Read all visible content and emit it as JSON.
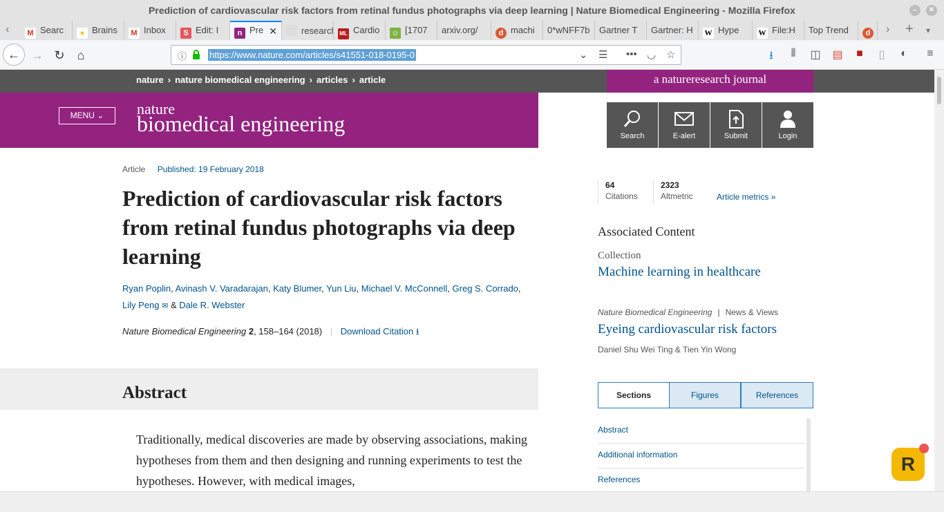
{
  "window": {
    "title": "Prediction of cardiovascular risk factors from retinal fundus photographs via deep learning | Nature Biomedical Engineering - Mozilla Firefox"
  },
  "tabs": [
    {
      "label": "Searc",
      "icon": "gmail-icon",
      "color": "#d93025"
    },
    {
      "label": "Brains",
      "icon": "bulb-icon",
      "color": "#f5c518"
    },
    {
      "label": "Inbox",
      "icon": "gmail-icon",
      "color": "#d93025"
    },
    {
      "label": "Edit: I",
      "icon": "s-icon",
      "color": "#e8555f"
    },
    {
      "label": "Pre",
      "icon": "nature-icon",
      "color": "#93237f"
    },
    {
      "label": "research.c",
      "icon": "blank-icon",
      "color": "#cccccc"
    },
    {
      "label": "Cardio",
      "icon": "ml-icon",
      "color": "#b71c1c"
    },
    {
      "label": "[1707",
      "icon": "smiley-icon",
      "color": "#7cb342"
    },
    {
      "label": "arxiv.org/",
      "icon": "blank-icon",
      "color": "#cccccc"
    },
    {
      "label": "machi",
      "icon": "duckduckgo-icon",
      "color": "#de5833"
    },
    {
      "label": "0*wNFF7b",
      "icon": "blank-icon",
      "color": "#cccccc"
    },
    {
      "label": "Gartner T",
      "icon": "blank-icon",
      "color": "#cccccc"
    },
    {
      "label": "Gartner: H",
      "icon": "blank-icon",
      "color": "#cccccc"
    },
    {
      "label": "Hype",
      "icon": "wikipedia-icon",
      "color": "#ffffff"
    },
    {
      "label": "File:H",
      "icon": "wikipedia-icon",
      "color": "#ffffff"
    },
    {
      "label": "Top Trend",
      "icon": "blank-icon",
      "color": "#cccccc"
    }
  ],
  "urlbar": {
    "url": "https://www.nature.com/articles/s41551-018-0195-0"
  },
  "site": {
    "breadcrumbs": [
      "nature",
      "nature biomedical engineering",
      "articles",
      "article"
    ],
    "nr_label": "a natureresearch journal",
    "menu_label": "MENU",
    "logo_line1": "nature",
    "logo_line2": "biomedical engineering",
    "actions": [
      "Search",
      "E-alert",
      "Submit",
      "Login"
    ]
  },
  "article": {
    "type": "Article",
    "published": "Published: 19 February 2018",
    "title": "Prediction of cardiovascular risk factors from retinal fundus photographs via deep learning",
    "authors": [
      "Ryan Poplin",
      "Avinash V. Varadarajan",
      "Katy Blumer",
      "Yun Liu",
      "Michael V. McConnell",
      "Greg S. Corrado",
      "Lily Peng",
      "Dale R. Webster"
    ],
    "journal": "Nature Biomedical Engineering",
    "volume": "2",
    "pages": ", 158–164 (2018)",
    "download_citation": "Download Citation",
    "abstract_heading": "Abstract",
    "abstract_text": "Traditionally, medical discoveries are made by observing associations, making hypotheses from them and then designing and running experiments to test the hypotheses. However, with medical images,"
  },
  "sidebar": {
    "citations_value": "64",
    "citations_label": "Citations",
    "altmetric_value": "2323",
    "altmetric_label": "Altmetric",
    "metrics_link": "Article metrics",
    "associated_heading": "Associated Content",
    "collection_label": "Collection",
    "collection_link": "Machine learning in healthcare",
    "nv_journal": "Nature Biomedical Engineering",
    "nv_type": "News & Views",
    "nv_title": "Eyeing cardiovascular risk factors",
    "nv_authors": "Daniel Shu Wei Ting & Tien Yin Wong",
    "section_tabs": [
      "Sections",
      "Figures",
      "References"
    ],
    "section_items": [
      "Abstract",
      "Additional information",
      "References"
    ]
  },
  "colors": {
    "nature_purple": "#93237f",
    "link_blue": "#00538c",
    "crumb_gray": "#555555"
  }
}
